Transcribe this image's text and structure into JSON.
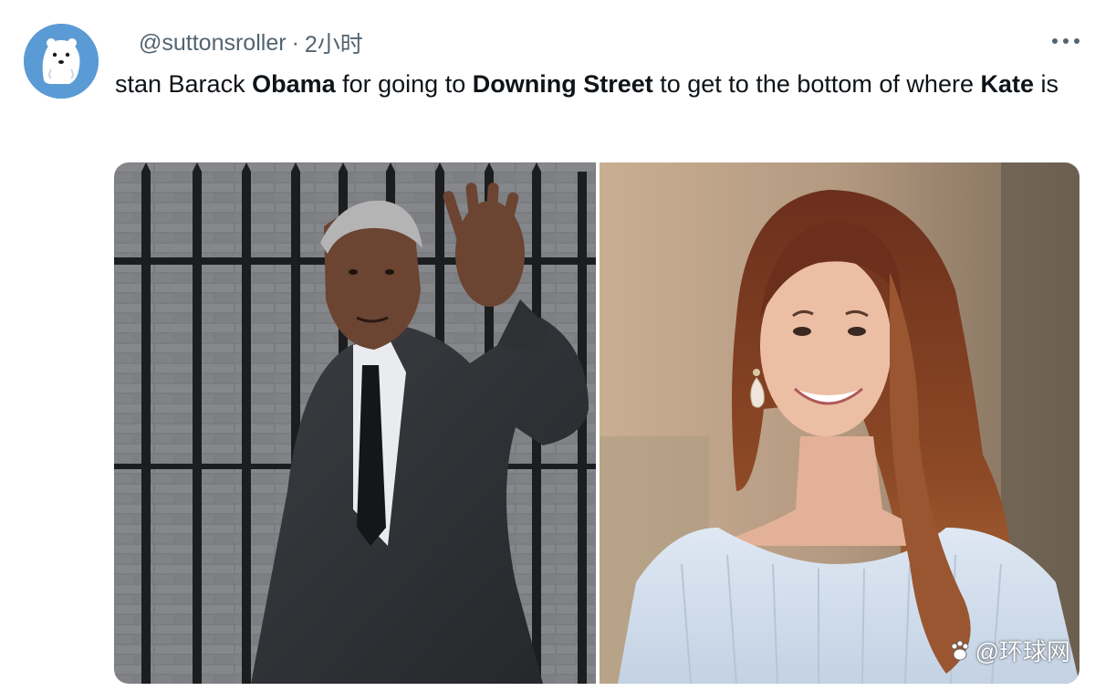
{
  "tweet": {
    "handle": "@suttonsroller",
    "separator": "·",
    "time": "2小时",
    "more_icon": "more-horizontal-icon",
    "text": {
      "t1": "stan Barack ",
      "b1": "Obama",
      "t2": " for going to ",
      "b2": "Downing Street",
      "t3": " to get to the bottom of where ",
      "b3": "Kate",
      "t4": " is"
    }
  },
  "media": {
    "left_photo": "photo-man-waving-suit-black-railings",
    "right_photo": "photo-woman-smiling-long-auburn-hair",
    "watermark": "@环球网",
    "watermark_icon": "paw-icon"
  },
  "colors": {
    "text": "#0f1419",
    "secondary": "#536471",
    "avatar_bg": "#5b9bd5"
  }
}
